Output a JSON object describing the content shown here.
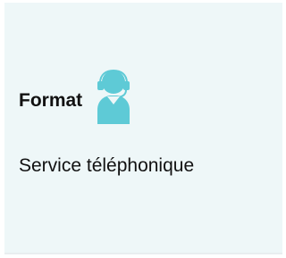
{
  "card": {
    "heading": "Format",
    "value": "Service téléphonique",
    "icon": "headset-support-icon",
    "accent_color": "#5ecad6",
    "background_color": "#eef7f8"
  }
}
